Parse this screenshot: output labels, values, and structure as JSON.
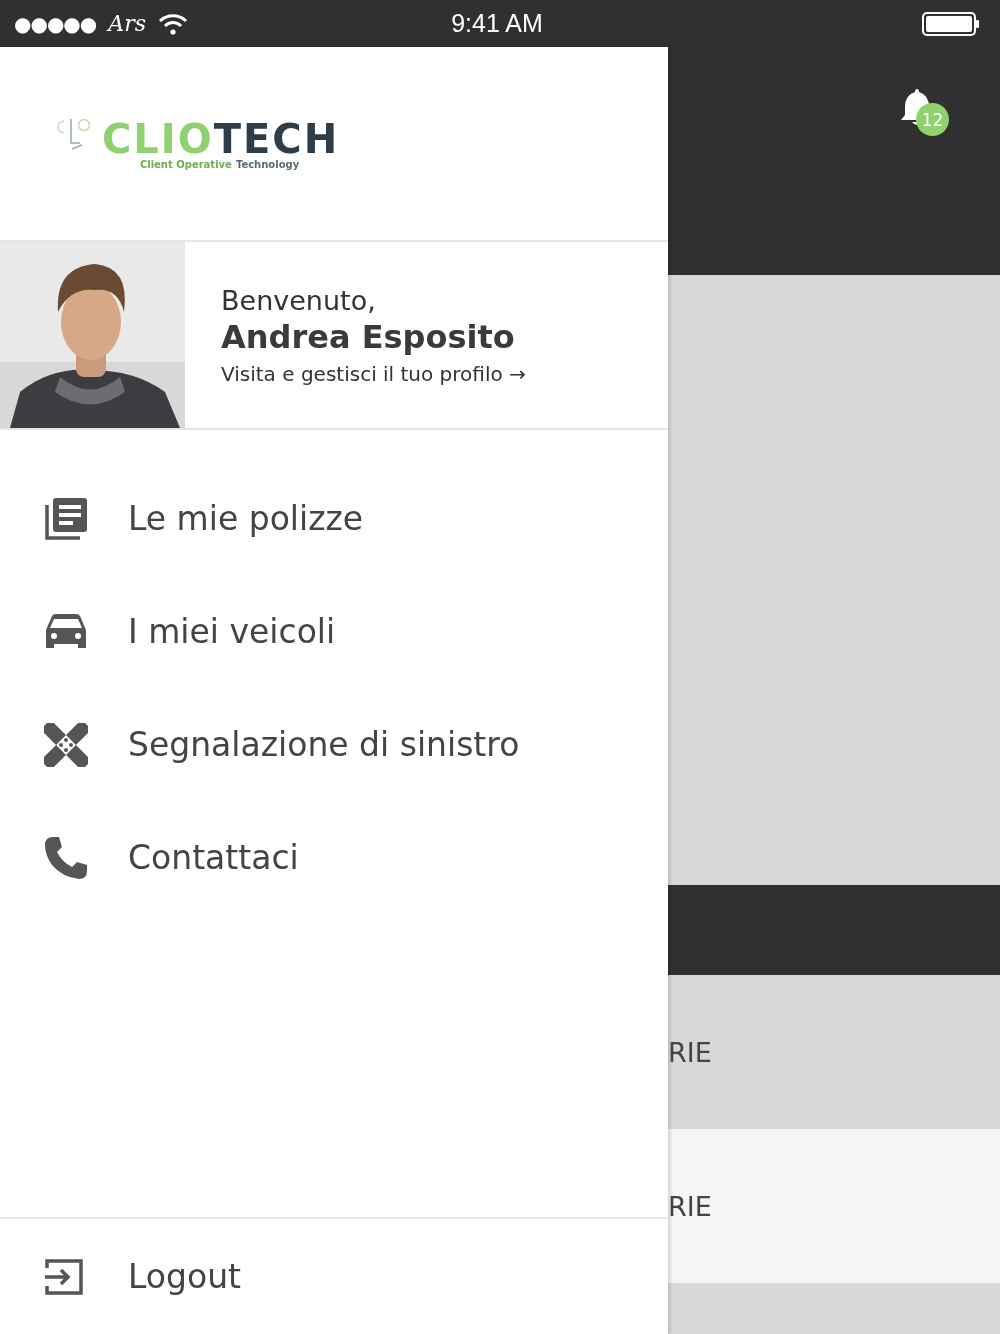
{
  "status_bar": {
    "signal_dots": "●●●●●",
    "carrier": "Ars",
    "time": "9:41 AM"
  },
  "drawer": {
    "logo": {
      "parts": [
        {
          "text": "CLIO",
          "color": "#8fd16f"
        },
        {
          "text": "TECH",
          "color": "#2e3d47"
        }
      ],
      "tagline": [
        {
          "text": "Client Operative",
          "color": "#6fae52"
        },
        {
          "text": "Technology",
          "color": "#5a6a72"
        }
      ]
    },
    "profile": {
      "greeting": "Benvenuto,",
      "name": "Andrea Esposito",
      "link": "Visita e gestisci il tuo profilo",
      "link_arrow": "→"
    },
    "menu": [
      {
        "kind": "policies",
        "label": "Le mie polizze"
      },
      {
        "kind": "vehicles",
        "label": "I miei veicoli"
      },
      {
        "kind": "claim",
        "label": "Segnalazione di sinistro"
      },
      {
        "kind": "contact",
        "label": "Contattaci"
      }
    ],
    "logout": {
      "label": "Logout"
    }
  },
  "background": {
    "notification_count": "12",
    "rows": [
      {
        "text": "RIE",
        "selected": false
      },
      {
        "text": "RIE",
        "selected": true
      }
    ]
  }
}
